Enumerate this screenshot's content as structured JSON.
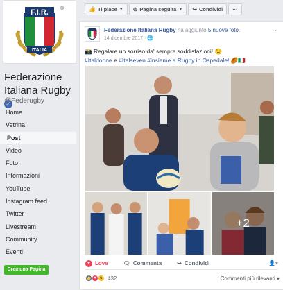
{
  "brand": {
    "logo_text": "F.I.R.",
    "logo_sub": "ITALIA",
    "registered": "®"
  },
  "page": {
    "name": "Federazione Italiana Rugby",
    "handle": "@Federugby",
    "verified_icon": "check-icon"
  },
  "nav": [
    {
      "label": "Home"
    },
    {
      "label": "Vetrina"
    },
    {
      "label": "Post",
      "active": true
    },
    {
      "label": "Video"
    },
    {
      "label": "Foto"
    },
    {
      "label": "Informazioni"
    },
    {
      "label": "YouTube"
    },
    {
      "label": "Instagram feed"
    },
    {
      "label": "Twitter"
    },
    {
      "label": "Livestream"
    },
    {
      "label": "Community"
    },
    {
      "label": "Eventi"
    }
  ],
  "create_page": "Crea una Pagina",
  "topbar": {
    "like": "Ti piace",
    "follow": "Pagina seguita",
    "share": "Condividi",
    "more": "···"
  },
  "post": {
    "author": "Federazione Italiana Rugby",
    "action_text": "ha aggiunto",
    "photos_link": "5 nuove foto.",
    "date": "14 dicembre 2017 · ",
    "line1": "Regalare un sorriso da' sempre soddisfazioni! 😉",
    "hashtag1": "#Italdonne",
    "conj": " e ",
    "hashtag2": "#Italseven",
    "hashtag3": "#insieme a Rugby in Ospedale!",
    "line2_tail": " 🏉🇮🇹",
    "more_photos": "+2"
  },
  "actions": {
    "love": "Love",
    "comment": "Commenta",
    "share": "Condividi"
  },
  "reactions": {
    "count": "432",
    "sort": "Commenti più rilevanti ▾"
  },
  "colors": {
    "fb_blue": "#4267b2",
    "link": "#365899",
    "love": "#f33e58",
    "green": "#42b72a"
  }
}
